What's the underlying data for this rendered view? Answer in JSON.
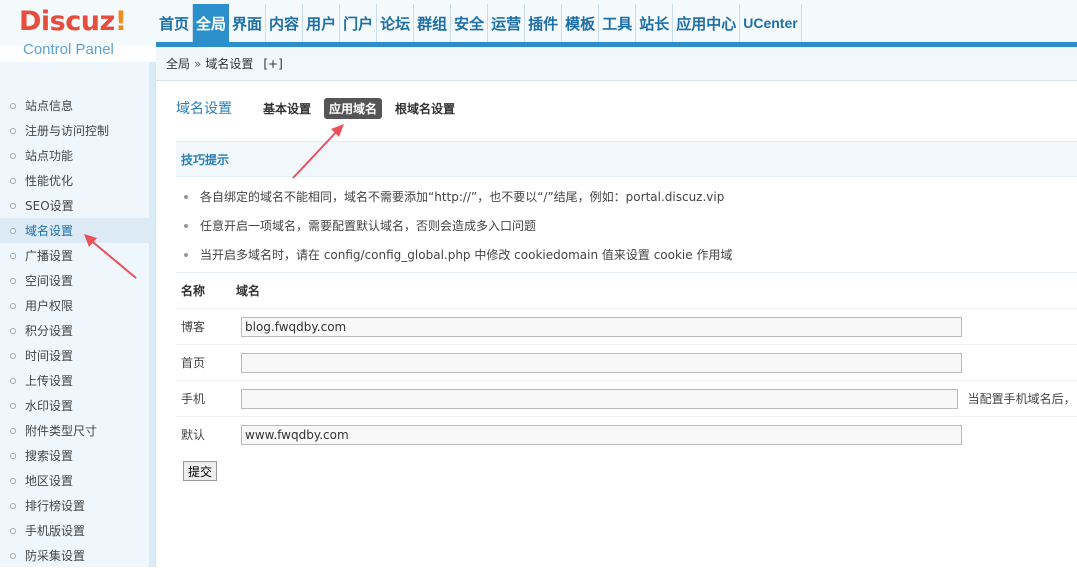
{
  "header": {
    "logo_brand": "Discuz",
    "logo_bang": "!",
    "logo_sub": "Control Panel",
    "nav": [
      "首页",
      "全局",
      "界面",
      "内容",
      "用户",
      "门户",
      "论坛",
      "群组",
      "安全",
      "运营",
      "插件",
      "模板",
      "工具",
      "站长",
      "应用中心",
      "UCenter"
    ],
    "active_nav": "全局"
  },
  "breadcrumb": {
    "root": "全局",
    "sep": "»",
    "current": "域名设置",
    "plus": "[+]"
  },
  "sidebar": {
    "items": [
      "站点信息",
      "注册与访问控制",
      "站点功能",
      "性能优化",
      "SEO设置",
      "域名设置",
      "广播设置",
      "空间设置",
      "用户权限",
      "积分设置",
      "时间设置",
      "上传设置",
      "水印设置",
      "附件类型尺寸",
      "搜索设置",
      "地区设置",
      "排行榜设置",
      "手机版设置",
      "防采集设置"
    ],
    "active": "域名设置"
  },
  "main": {
    "title": "域名设置",
    "tabs": [
      "基本设置",
      "应用域名",
      "根域名设置"
    ],
    "active_tab": "应用域名",
    "tips_title": "技巧提示",
    "tips": [
      "各自绑定的域名不能相同，域名不需要添加“http://”，也不要以“/”结尾，例如：portal.discuz.vip",
      "任意开启一项域名，需要配置默认域名，否则会造成多入口问题",
      "当开启多域名时，请在 config/config_global.php 中修改 cookiedomain 值来设置 cookie 作用域"
    ],
    "table_headers": [
      "名称",
      "域名"
    ],
    "rows": [
      {
        "label": "博客",
        "value": "blog.fwqdby.com",
        "note": ""
      },
      {
        "label": "首页",
        "value": "",
        "note": ""
      },
      {
        "label": "手机",
        "value": "",
        "note": "当配置手机域名后，"
      },
      {
        "label": "默认",
        "value": "www.fwqdby.com",
        "note": ""
      }
    ],
    "submit_label": "提交"
  },
  "annotation_color": "#e8505a"
}
